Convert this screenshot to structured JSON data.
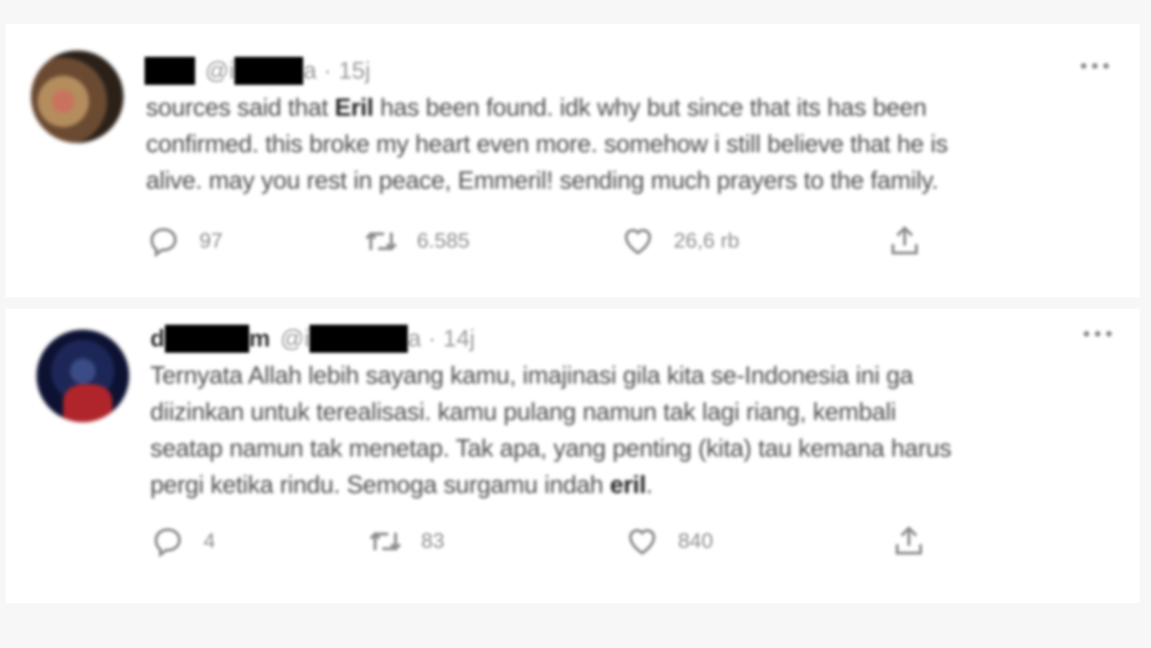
{
  "tweets": [
    {
      "name_fragments": [
        "",
        ""
      ],
      "handle_prefix": "@i",
      "handle_suffix": "a",
      "separator": "·",
      "time": "15j",
      "lines": [
        {
          "pre": "sources said that ",
          "bold": "Eril",
          "post": " has been found. idk why but since that its has been"
        },
        {
          "pre": "confirmed. this broke my heart even more. somehow i still believe that he is",
          "bold": "",
          "post": ""
        },
        {
          "pre": "alive. may you rest in peace, Emmeril! sending much prayers to the family.",
          "bold": "",
          "post": ""
        }
      ],
      "counts": {
        "reply": "97",
        "retweet": "6.585",
        "like": "26,6 rb"
      },
      "icons": {
        "more": "more-dots-icon",
        "reply": "reply-icon",
        "retweet": "retweet-icon",
        "like": "heart-icon",
        "share": "share-icon"
      }
    },
    {
      "name_fragments": [
        "d",
        "m"
      ],
      "handle_prefix": "@i",
      "handle_suffix": "a",
      "separator": "·",
      "time": "14j",
      "lines": [
        {
          "pre": "Ternyata Allah lebih sayang kamu, imajinasi gila kita se-Indonesia ini ga",
          "bold": "",
          "post": ""
        },
        {
          "pre": "diizinkan untuk terealisasi. kamu pulang namun tak lagi riang, kembali",
          "bold": "",
          "post": ""
        },
        {
          "pre": "seatap namun tak menetap. Tak apa, yang penting (kita) tau kemana harus",
          "bold": "",
          "post": ""
        },
        {
          "pre": "pergi ketika rindu. Semoga surgamu indah ",
          "bold": "eril",
          "post": "."
        }
      ],
      "counts": {
        "reply": "4",
        "retweet": "83",
        "like": "840"
      },
      "icons": {
        "more": "more-dots-icon",
        "reply": "reply-icon",
        "retweet": "retweet-icon",
        "like": "heart-icon",
        "share": "share-icon"
      }
    }
  ],
  "colors": {
    "background": "#f7f7f8",
    "card": "#ffffff",
    "text": "#4a4a4a",
    "muted": "#8c8c8c",
    "redaction": "#000000"
  }
}
